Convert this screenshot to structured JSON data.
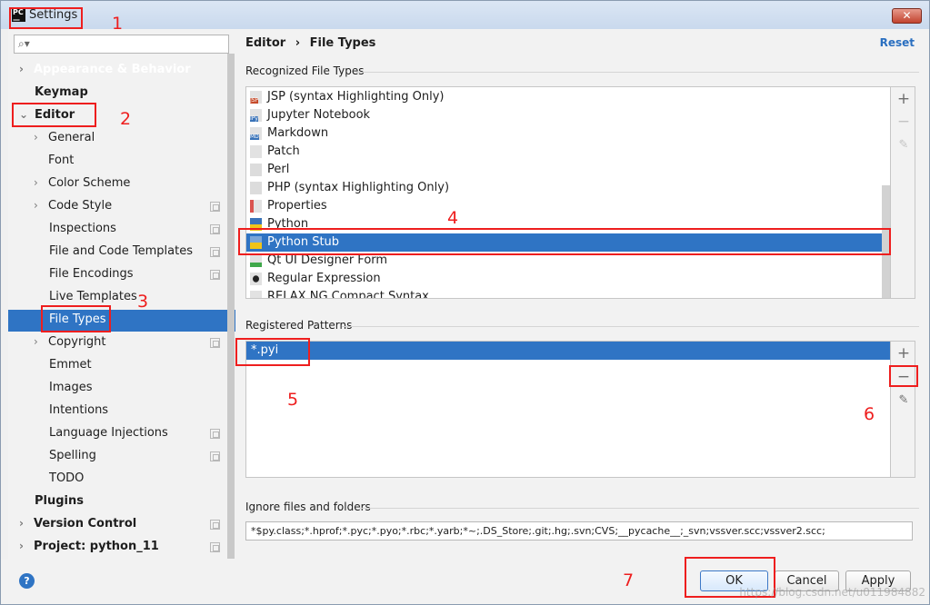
{
  "window": {
    "title": "Settings",
    "close": "✕"
  },
  "sidebar": {
    "search_placeholder": "",
    "items": [
      {
        "label": "Appearance & Behavior"
      },
      {
        "label": "Keymap"
      },
      {
        "label": "Editor"
      },
      {
        "label": "General"
      },
      {
        "label": "Font"
      },
      {
        "label": "Color Scheme"
      },
      {
        "label": "Code Style"
      },
      {
        "label": "Inspections"
      },
      {
        "label": "File and Code Templates"
      },
      {
        "label": "File Encodings"
      },
      {
        "label": "Live Templates"
      },
      {
        "label": "File Types"
      },
      {
        "label": "Copyright"
      },
      {
        "label": "Emmet"
      },
      {
        "label": "Images"
      },
      {
        "label": "Intentions"
      },
      {
        "label": "Language Injections"
      },
      {
        "label": "Spelling"
      },
      {
        "label": "TODO"
      },
      {
        "label": "Plugins"
      },
      {
        "label": "Version Control"
      },
      {
        "label": "Project: python_11"
      }
    ]
  },
  "main": {
    "breadcrumb_parent": "Editor",
    "breadcrumb_sep": "›",
    "breadcrumb_current": "File Types",
    "reset": "Reset",
    "recognized_label": "Recognized File Types",
    "file_types": [
      {
        "label": "JSP (syntax Highlighting Only)",
        "icon": "JSP"
      },
      {
        "label": "Jupyter Notebook",
        "icon": "IPy"
      },
      {
        "label": "Markdown",
        "icon": "MD"
      },
      {
        "label": "Patch",
        "icon": ""
      },
      {
        "label": "Perl",
        "icon": ""
      },
      {
        "label": "PHP (syntax Highlighting Only)",
        "icon": ""
      },
      {
        "label": "Properties",
        "icon": ""
      },
      {
        "label": "Python",
        "icon": ""
      },
      {
        "label": "Python Stub",
        "icon": ""
      },
      {
        "label": "Qt UI Designer Form",
        "icon": ""
      },
      {
        "label": "Regular Expression",
        "icon": ""
      },
      {
        "label": "RELAX NG Compact Syntax",
        "icon": ""
      }
    ],
    "patterns_label": "Registered Patterns",
    "patterns": [
      "*.pyi"
    ],
    "ignore_label": "Ignore files and folders",
    "ignore_value": "*$py.class;*.hprof;*.pyc;*.pyo;*.rbc;*.yarb;*~;.DS_Store;.git;.hg;.svn;CVS;__pycache__;_svn;vssver.scc;vssver2.scc;"
  },
  "footer": {
    "help": "?",
    "ok": "OK",
    "cancel": "Cancel",
    "apply": "Apply"
  },
  "annotations": [
    "1",
    "2",
    "3",
    "4",
    "5",
    "6",
    "7"
  ],
  "watermark": "https://blog.csdn.net/u011984882",
  "colors": {
    "selection": "#2f74c4",
    "annotation": "#ee1e1e",
    "link": "#2a6fc0"
  }
}
